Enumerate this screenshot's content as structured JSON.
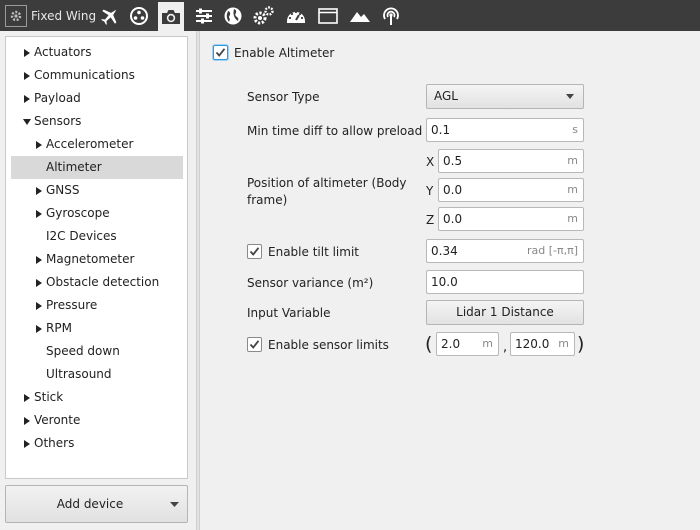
{
  "toolbar": {
    "app_title": "Fixed Wing",
    "icons": [
      "plane-icon",
      "dots-circle-icon",
      "camera-icon",
      "sliders-icon",
      "globe-icon",
      "gears-icon",
      "dashboard-gauge-icon",
      "window-icon",
      "mountain-icon",
      "signal-antenna-icon"
    ],
    "active_icon": "camera-icon"
  },
  "sidebar": {
    "items": [
      {
        "label": "Actuators",
        "arrow": "right"
      },
      {
        "label": "Communications",
        "arrow": "right"
      },
      {
        "label": "Payload",
        "arrow": "right"
      },
      {
        "label": "Sensors",
        "arrow": "down"
      },
      {
        "label": "Accelerometer",
        "arrow": "right"
      },
      {
        "label": "Altimeter",
        "arrow": "none",
        "selected": true
      },
      {
        "label": "GNSS",
        "arrow": "right"
      },
      {
        "label": "Gyroscope",
        "arrow": "right"
      },
      {
        "label": "I2C Devices",
        "arrow": "none"
      },
      {
        "label": "Magnetometer",
        "arrow": "right"
      },
      {
        "label": "Obstacle detection",
        "arrow": "right"
      },
      {
        "label": "Pressure",
        "arrow": "right"
      },
      {
        "label": "RPM",
        "arrow": "right"
      },
      {
        "label": "Speed down",
        "arrow": "none"
      },
      {
        "label": "Ultrasound",
        "arrow": "none"
      },
      {
        "label": "Stick",
        "arrow": "right"
      },
      {
        "label": "Veronte",
        "arrow": "right"
      },
      {
        "label": "Others",
        "arrow": "right"
      }
    ],
    "add_device_label": "Add device"
  },
  "altimeter": {
    "enable_label": "Enable Altimeter",
    "enable_checked": true,
    "sensor_type_label": "Sensor Type",
    "sensor_type_value": "AGL",
    "min_time_label": "Min time diff to allow preload",
    "min_time_value": "0.1",
    "min_time_unit": "s",
    "position_label": "Position of altimeter (Body frame)",
    "position": {
      "x_label": "X",
      "x_value": "0.5",
      "x_unit": "m",
      "y_label": "Y",
      "y_value": "0.0",
      "y_unit": "m",
      "z_label": "Z",
      "z_value": "0.0",
      "z_unit": "m"
    },
    "tilt_label": "Enable tilt limit",
    "tilt_checked": true,
    "tilt_value": "0.34",
    "tilt_unit": "rad [-π,π]",
    "variance_label": "Sensor variance (m²)",
    "variance_value": "10.0",
    "input_variable_label": "Input Variable",
    "input_variable_value": "Lidar 1 Distance",
    "limits_label": "Enable sensor limits",
    "limits_checked": true,
    "limits_open": "(",
    "limits_min": "2.0",
    "limits_min_unit": "m",
    "limits_sep": ",",
    "limits_max": "120.0",
    "limits_max_unit": "m",
    "limits_close": ")"
  },
  "colors": {
    "toolbar_bg": "#3c3c3c",
    "selected_item_bg": "#d9d9d9",
    "focus_blue": "#3399dd",
    "icon_white": "#ffffff"
  }
}
